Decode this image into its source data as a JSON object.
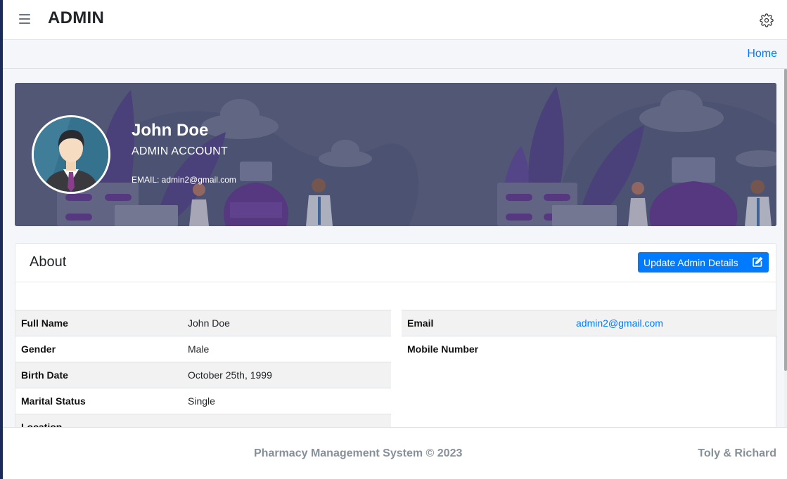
{
  "header": {
    "brand": "ADMIN"
  },
  "breadcrumb": {
    "home_label": "Home"
  },
  "profile": {
    "name": "John Doe",
    "role": "ADMIN ACCOUNT",
    "email_line": "EMAIL: admin2@gmail.com"
  },
  "about": {
    "title": "About",
    "update_button_label": "Update Admin Details",
    "left_rows": [
      {
        "label": "Full Name",
        "value": "John Doe"
      },
      {
        "label": "Gender",
        "value": "Male"
      },
      {
        "label": "Birth Date",
        "value": "October 25th, 1999"
      },
      {
        "label": "Marital Status",
        "value": "Single"
      },
      {
        "label": "Location",
        "value": ""
      }
    ],
    "right_rows": [
      {
        "label": "Email",
        "value": "admin2@gmail.com"
      },
      {
        "label": "Mobile Number",
        "value": ""
      }
    ]
  },
  "footer": {
    "copyright": "Pharmacy Management System © 2023",
    "authors": "Toly & Richard"
  },
  "colors": {
    "accent": "#007bff",
    "banner_overlay": "#555a78",
    "footer_text": "#869099"
  },
  "icons": {
    "menu": "hamburger-icon",
    "settings": "gear-icon",
    "edit": "edit-icon"
  }
}
